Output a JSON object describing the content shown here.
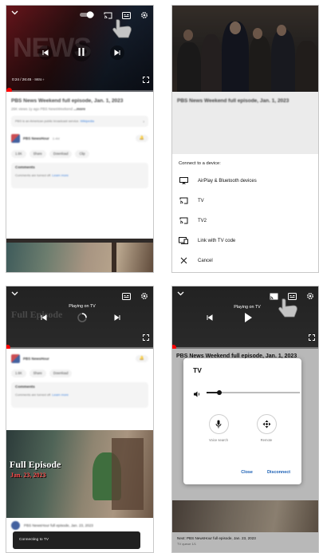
{
  "panel_1": {
    "time": "0:24 / 26:45",
    "chapter": "Intro",
    "video_title": "PBS News Weekend full episode, Jan. 1, 2023",
    "video_meta": "26K views 1y ago PBS NewsWeekend",
    "video_meta_more": "...more",
    "notice_text": "PBS is an American public broadcast service.",
    "notice_link": "Wikipedia",
    "channel_name": "PBS NewsHour",
    "channel_subs": "3.4M",
    "chips": [
      "1.6K",
      "Share",
      "Download",
      "Clip"
    ],
    "comments_heading": "Comments",
    "comments_text": "Comments are turned off.",
    "comments_link": "Learn more",
    "progress_fraction": 0.015
  },
  "panel_2": {
    "bg_title": "PBS News Weekend full episode, Jan. 1, 2023",
    "sheet_title": "Connect to a device:",
    "options": [
      {
        "icon": "airplay-icon",
        "label": "AirPlay & Bluetooth devices"
      },
      {
        "icon": "cast-icon",
        "label": "TV"
      },
      {
        "icon": "cast-icon",
        "label": "TV2"
      },
      {
        "icon": "tv-code-icon",
        "label": "Link with TV code"
      },
      {
        "icon": "close-icon",
        "label": "Cancel"
      }
    ]
  },
  "panel_3": {
    "status": "Playing on TV",
    "thumb_title_1": "Full Episode",
    "thumb_title_2": "Jan. 23, 2023",
    "next_title": "PBS NewsHour full episode, Jan. 23, 2023",
    "toast": "Connecting to TV"
  },
  "panel_4": {
    "status": "Playing on TV",
    "dialog_title": "TV",
    "volume_level": 0.14,
    "voice_search_label": "Voice search",
    "remote_label": "Remote",
    "close_label": "Close",
    "disconnect_label": "Disconnect",
    "next_title": "Next: PBS NewsHour full episode, Jan. 23, 2023",
    "next_meta": "TV queue 1/1"
  },
  "colors": {
    "accent_red": "#ff0000",
    "link_blue": "#065fd4",
    "dialog_action_blue": "#1a5fb4"
  }
}
